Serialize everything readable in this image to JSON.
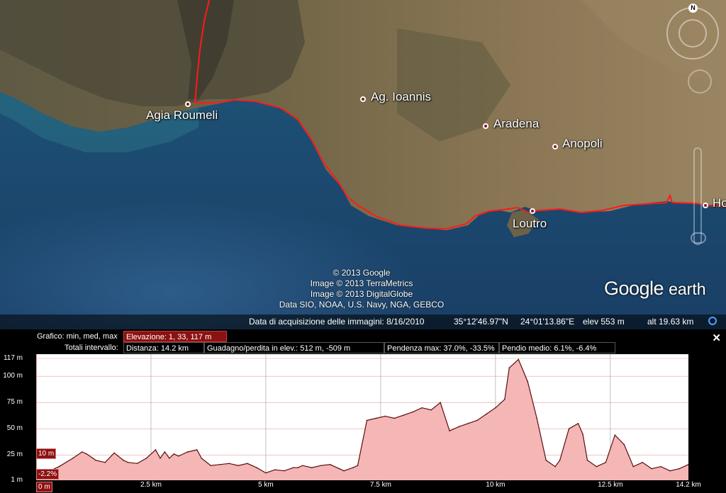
{
  "map": {
    "places": {
      "agia_roumeli": "Agia Roumeli",
      "ag_ioannis": "Ag. Ioannis",
      "aradena": "Aradena",
      "anopoli": "Anopoli",
      "loutro": "Loutro",
      "hora": "Ho"
    },
    "credits": [
      "© 2013 Google",
      "Image © 2013 TerraMetrics",
      "Image © 2013 DigitalGlobe",
      "Data SIO, NOAA, U.S. Navy, NGA, GEBCO"
    ],
    "logo": {
      "brand": "Google",
      "product": "earth"
    },
    "north_label": "N",
    "status": {
      "imagery_date": "Data di acquisizione delle immagini: 8/16/2010",
      "latitude": "35°12'46.97\"N",
      "longitude": "24°01'13.86\"E",
      "elevation": "elev   553 m",
      "altitude": "alt  19.63 km"
    },
    "colors": {
      "track": "#ff1a1a",
      "sea": "#1f4f78",
      "land": "#8b7a55"
    }
  },
  "profile": {
    "header": {
      "graph_label": "Grafico: min, med, max",
      "elevation_summary": "Elevazione: 1, 33, 117 m",
      "totals_label": "Totali intervallo:",
      "distance": "Distanza: 14.2 km",
      "gain_loss": "Guadagno/perdita in elev.: 512 m, -509 m",
      "max_slope": "Pendenza max: 37.0%, -33.5%",
      "avg_slope": "Pendio medio: 6.1%, -6.4%"
    },
    "close_label": "✕",
    "cursor_tags": {
      "elevation": "10 m",
      "slope": "-2.2%",
      "distance": "0 m"
    },
    "colors": {
      "fill": "#f5b6b6",
      "line": "#5a0e0e",
      "tag": "#8c1212"
    }
  },
  "chart_data": {
    "type": "area",
    "title": "",
    "xlabel": "",
    "ylabel": "",
    "x_unit": "km",
    "y_unit": "m",
    "xlim": [
      0,
      14.2
    ],
    "ylim": [
      1,
      117
    ],
    "y_ticks": [
      {
        "value": 117,
        "label": "117 m"
      },
      {
        "value": 100,
        "label": "100 m"
      },
      {
        "value": 75,
        "label": "75 m"
      },
      {
        "value": 50,
        "label": "50 m"
      },
      {
        "value": 25,
        "label": "25 m"
      },
      {
        "value": 1,
        "label": "1 m"
      }
    ],
    "x_ticks": [
      {
        "value": 2.5,
        "label": "2.5 km"
      },
      {
        "value": 5,
        "label": "5 km"
      },
      {
        "value": 7.5,
        "label": "7.5 km"
      },
      {
        "value": 10,
        "label": "10 km"
      },
      {
        "value": 12.5,
        "label": "12.5 km"
      },
      {
        "value": 14.2,
        "label": "14.2 km"
      }
    ],
    "grid": true,
    "series": [
      {
        "x": [
          0,
          0.2,
          0.5,
          0.8,
          1.0,
          1.1,
          1.3,
          1.5,
          1.7,
          1.9,
          2.0,
          2.2,
          2.4,
          2.6,
          2.7,
          2.8,
          2.9,
          3.0,
          3.1,
          3.3,
          3.5,
          3.6,
          3.8,
          4.0,
          4.2,
          4.4,
          4.6,
          4.8,
          5.0,
          5.2,
          5.4,
          5.6,
          5.7,
          5.8,
          6.0,
          6.2,
          6.4,
          6.6,
          6.7,
          6.9,
          7.0,
          7.2,
          7.4,
          7.6,
          7.8,
          8.0,
          8.2,
          8.4,
          8.6,
          8.8,
          9.0,
          9.2,
          9.4,
          9.6,
          9.8,
          10.0,
          10.2,
          10.3,
          10.5,
          10.7,
          10.9,
          11.1,
          11.3,
          11.4,
          11.6,
          11.8,
          11.9,
          12.0,
          12.2,
          12.4,
          12.6,
          12.8,
          13.0,
          13.2,
          13.4,
          13.6,
          13.8,
          14.0,
          14.2
        ],
        "y": [
          10,
          8,
          14,
          22,
          28,
          26,
          20,
          18,
          27,
          20,
          18,
          17,
          22,
          30,
          22,
          28,
          22,
          26,
          24,
          28,
          30,
          22,
          15,
          16,
          17,
          15,
          17,
          13,
          8,
          11,
          10,
          13,
          13,
          15,
          13,
          15,
          16,
          12,
          10,
          13,
          15,
          58,
          60,
          62,
          60,
          63,
          66,
          70,
          68,
          75,
          48,
          52,
          55,
          58,
          64,
          70,
          78,
          108,
          116,
          95,
          60,
          20,
          14,
          20,
          50,
          55,
          45,
          20,
          14,
          18,
          44,
          35,
          14,
          18,
          12,
          14,
          10,
          12,
          16
        ]
      }
    ]
  }
}
